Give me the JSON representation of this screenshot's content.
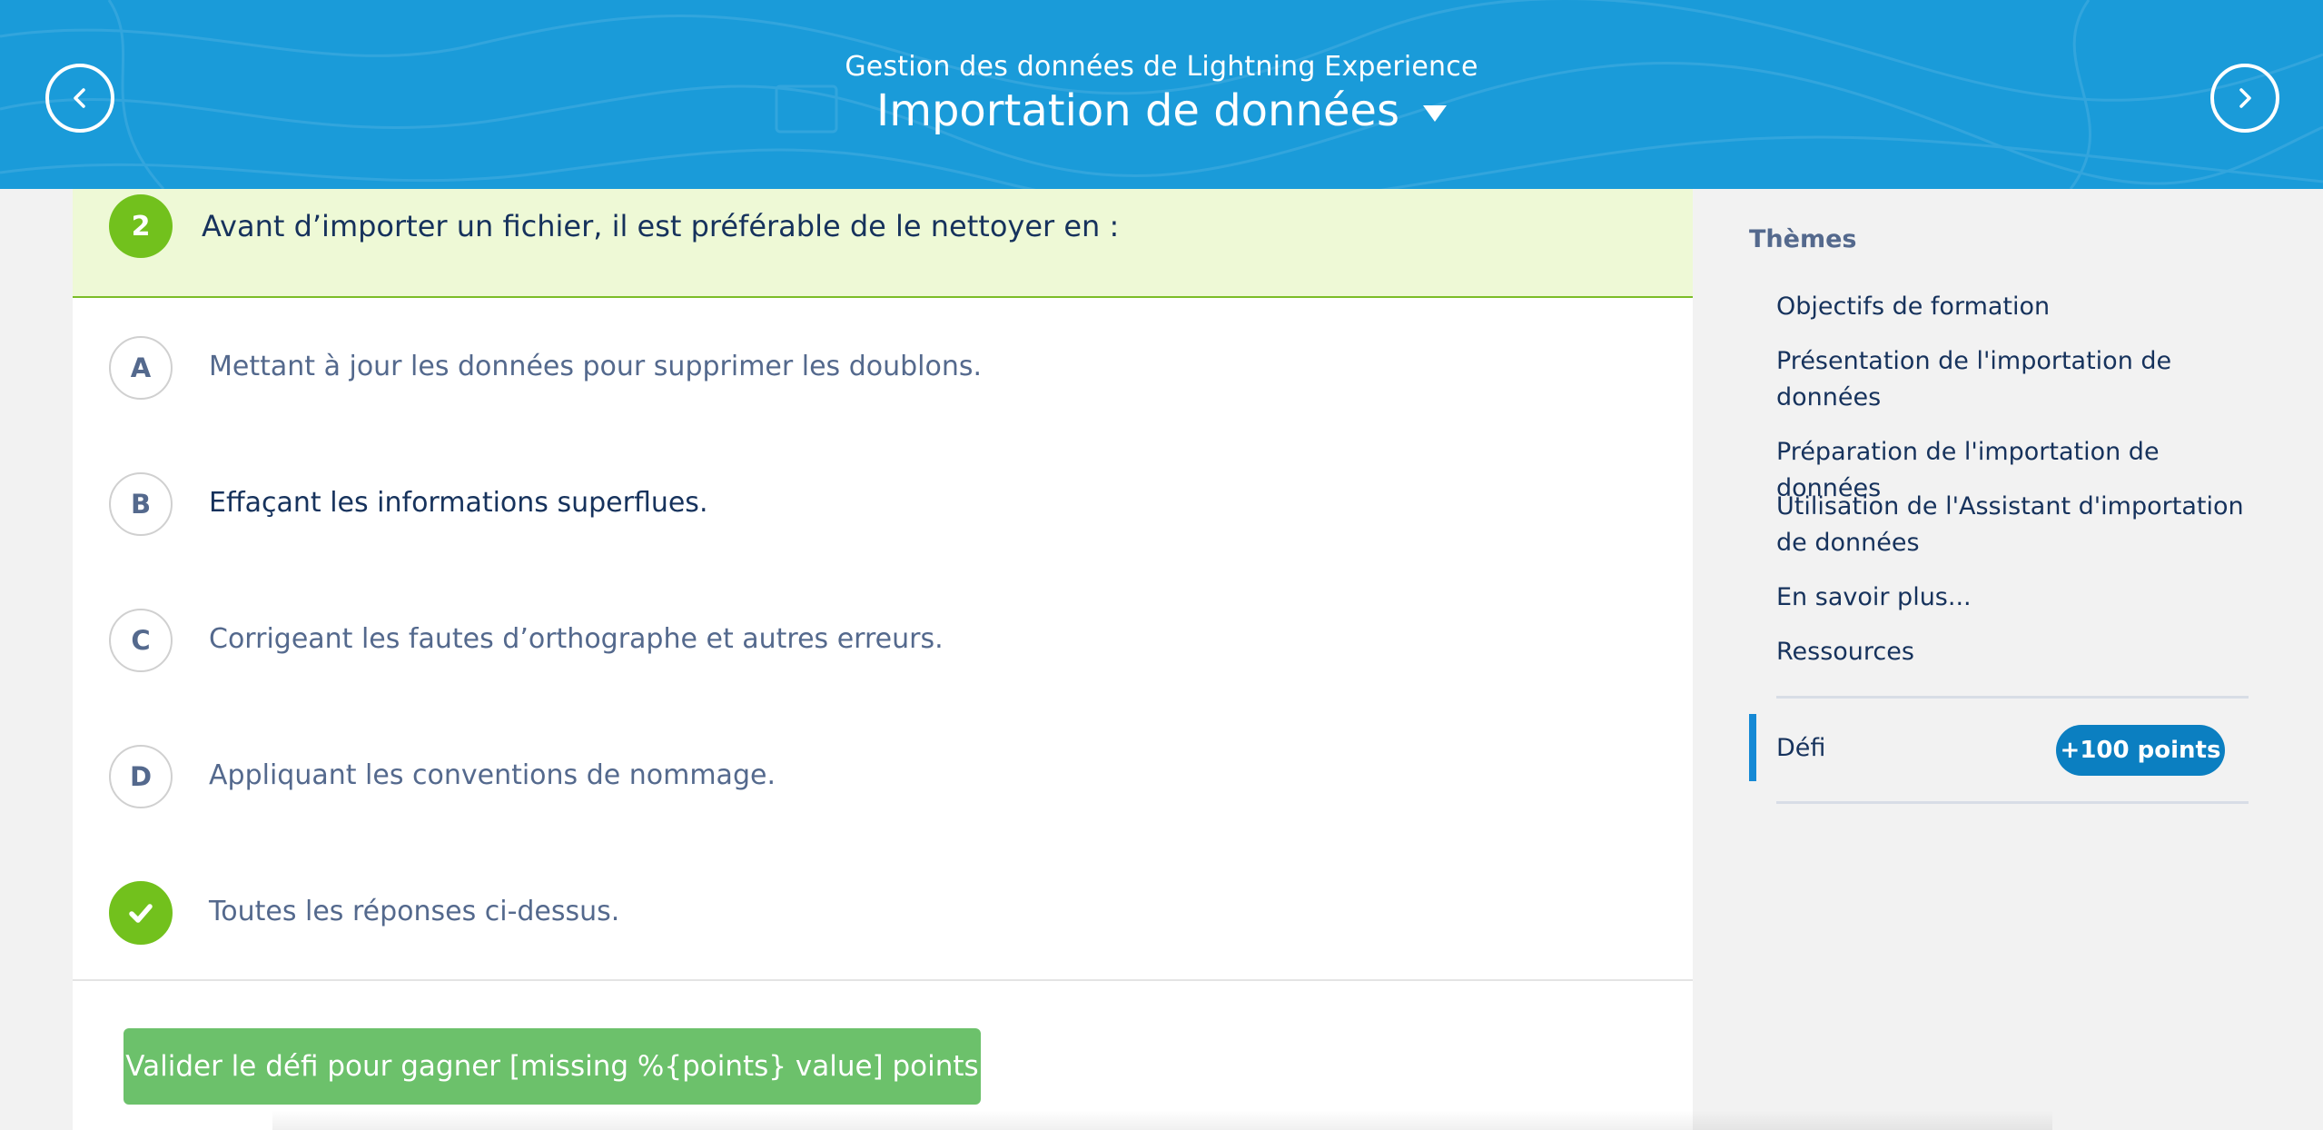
{
  "header": {
    "subtitle": "Gestion des données de Lightning Experience",
    "title": "Importation de données",
    "background_color": "#1a9bd9"
  },
  "question": {
    "number": "2",
    "text": "Avant d’importer un fichier, il est préférable de le nettoyer en :"
  },
  "answers": [
    {
      "letter": "A",
      "text": "Mettant à jour les données pour supprimer les doublons."
    },
    {
      "letter": "B",
      "text": "Effaçant les informations superflues."
    },
    {
      "letter": "C",
      "text": "Corrigeant les fautes d’orthographe et autres erreurs."
    },
    {
      "letter": "D",
      "text": "Appliquant les conventions de nommage."
    },
    {
      "letter": "",
      "text": "Toutes les réponses ci-dessus.",
      "selected": true
    }
  ],
  "submit": {
    "label": "Valider le défi pour gagner [missing %{points} value] points",
    "color": "#6cc16b"
  },
  "sidebar": {
    "heading": "Thèmes",
    "items": [
      {
        "label": "Objectifs de formation"
      },
      {
        "label": "Présentation de l'importation de données"
      },
      {
        "label": "Préparation de l'importation de données"
      },
      {
        "label": "Utilisation de l'Assistant d'importation de données"
      },
      {
        "label": "En savoir plus..."
      },
      {
        "label": "Ressources"
      }
    ],
    "challenge": {
      "label": "Défi",
      "points": "+100 points",
      "accent_color": "#1589d5"
    }
  },
  "icons": {
    "prev": "chevron-left-icon",
    "next": "chevron-right-icon",
    "dropdown": "caret-down-icon",
    "selected_answer": "check-icon"
  }
}
